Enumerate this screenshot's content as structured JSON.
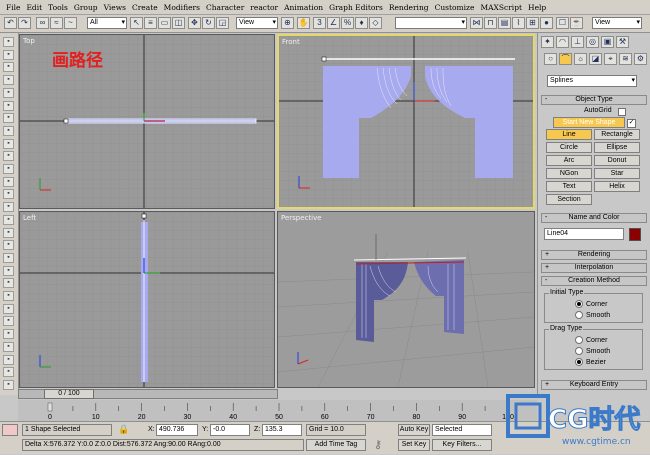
{
  "menu": [
    "File",
    "Edit",
    "Tools",
    "Group",
    "Views",
    "Create",
    "Modifiers",
    "Character",
    "reactor",
    "Animation",
    "Graph Editors",
    "Rendering",
    "Customize",
    "MAXScript",
    "Help"
  ],
  "toolbar": {
    "selection_filter": "All",
    "ref_coord": "View",
    "view_right": "View"
  },
  "annotation": "画路径",
  "viewports": {
    "top": "Top",
    "front": "Front",
    "left": "Left",
    "perspective": "Perspective"
  },
  "command_panel": {
    "category": "Splines",
    "object_type": {
      "title": "Object Type",
      "autogrid": "AutoGrid",
      "start_new_shape": "Start New Shape",
      "buttons": [
        "Line",
        "Rectangle",
        "Circle",
        "Ellipse",
        "Arc",
        "Donut",
        "NGon",
        "Star",
        "Text",
        "Helix",
        "Section"
      ]
    },
    "name_color": {
      "title": "Name and Color",
      "name": "Line04",
      "color": "#8b0000"
    },
    "rendering": "Rendering",
    "interpolation": "Interpolation",
    "creation_method": {
      "title": "Creation Method",
      "initial_type": {
        "title": "Initial Type",
        "options": [
          "Corner",
          "Smooth"
        ],
        "selected": "Corner"
      },
      "drag_type": {
        "title": "Drag Type",
        "options": [
          "Corner",
          "Smooth",
          "Bezier"
        ],
        "selected": "Bezier"
      }
    },
    "keyboard_entry": "Keyboard Entry"
  },
  "time": {
    "frame": "0 / 100",
    "ticks": [
      "0",
      "10",
      "20",
      "30",
      "40",
      "50",
      "60",
      "70",
      "80",
      "90",
      "100"
    ]
  },
  "status": {
    "selection": "1 Shape Selected",
    "x_label": "X:",
    "x": "490.736",
    "y_label": "Y:",
    "y": "-0.0",
    "z_label": "Z:",
    "z": "135.3",
    "grid": "Grid = 10.0",
    "auto_key": "Auto Key",
    "selected": "Selected",
    "set_key": "Set Key",
    "key_filters": "Key Filters...",
    "prompt": "Delta X:576.372  Y:0.0  Z:0.0  Dist:576.372  Ang:90.00  RAng:0.00",
    "add_time_tag": "Add Time Tag"
  },
  "watermark": {
    "brand": "CG时代",
    "url": "www.cgtime.cn"
  }
}
